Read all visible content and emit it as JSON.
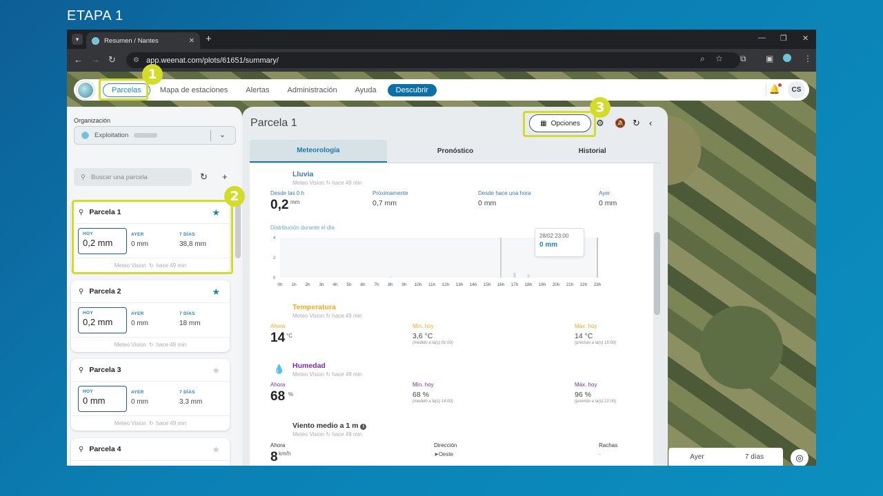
{
  "stage_title": "ETAPA 1",
  "browser": {
    "tab_title": "Resumen / Nantes",
    "url": "app.weenat.com/plots/61651/summary/"
  },
  "header": {
    "nav": [
      "Parcelas",
      "Mapa de estaciones",
      "Alertas",
      "Administración",
      "Ayuda"
    ],
    "discover_label": "Descubrir",
    "avatar_initials": "CS"
  },
  "sidebar": {
    "org_label": "Organización",
    "org_value": "Exploitation",
    "search_placeholder": "Buscar una parcela",
    "col_today": "HOY",
    "col_yesterday": "AYER",
    "col_week": "7 DÍAS",
    "footer_source": "Meteo Vision",
    "footer_time": "hace 49 min",
    "parcels": [
      {
        "name": "Parcela 1",
        "today": "0,2 mm",
        "yesterday": "0 mm",
        "week": "38,8 mm",
        "favorite": true
      },
      {
        "name": "Parcela 2",
        "today": "0,2 mm",
        "yesterday": "0 mm",
        "week": "18 mm",
        "favorite": true
      },
      {
        "name": "Parcela 3",
        "today": "0 mm",
        "yesterday": "0 mm",
        "week": "3,3 mm",
        "favorite": false
      },
      {
        "name": "Parcela 4",
        "today": "",
        "yesterday": "",
        "week": "",
        "favorite": false
      }
    ]
  },
  "main": {
    "title": "Parcela 1",
    "options_label": "Opciones",
    "tabs": [
      "Meteorología",
      "Pronóstico",
      "Historial"
    ],
    "source": "Meteo Vision",
    "time": "hace 49 min",
    "rain": {
      "title": "Lluvia",
      "lbl_since": "Desde las 0 h",
      "val_since": "0,2",
      "unit_since": "mm",
      "lbl_soon": "Próximamente",
      "val_soon": "0,7 mm",
      "lbl_hour": "Desde hace una hora",
      "val_hour": "0 mm",
      "lbl_yesterday": "Ayer",
      "val_yesterday": "0 mm",
      "chart_caption": "Distribución durante el día",
      "tooltip_date": "28/02 23:00",
      "tooltip_value": "0 mm"
    },
    "temperature": {
      "title": "Temperatura",
      "lbl_now": "Ahora",
      "val_now": "14",
      "unit": "°C",
      "lbl_min": "Mín. hoy",
      "val_min": "3,6 °C",
      "note_min": "(medido a la(s) 01:00)",
      "lbl_max": "Máx. hoy",
      "val_max": "14 °C",
      "note_max": "(previsto a la(s) 15:00)"
    },
    "humidity": {
      "title": "Humedad",
      "lbl_now": "Ahora",
      "val_now": "68",
      "unit": "%",
      "lbl_min": "Mín. hoy",
      "val_min": "68  %",
      "note_min": "(medido a la(s) 14:00)",
      "lbl_max": "Máx. hoy",
      "val_max": "96  %",
      "note_max": "(previsto a la(s) 21:00)"
    },
    "wind": {
      "title": "Viento medio a 1 m",
      "lbl_now": "Ahora",
      "val_now": "8",
      "unit": "km/h",
      "lbl_dir": "Dirección",
      "val_dir": "Oeste",
      "lbl_gusts": "Rachas",
      "val_gusts": "-"
    }
  },
  "map_tabs": [
    "Ayer",
    "7 días"
  ],
  "annotations": [
    "1",
    "2",
    "3"
  ],
  "chart_data": {
    "type": "bar",
    "categories": [
      "0h",
      "1h",
      "2h",
      "3h",
      "4h",
      "5h",
      "6h",
      "7h",
      "8h",
      "9h",
      "10h",
      "11h",
      "12h",
      "13h",
      "14h",
      "15h",
      "16h",
      "17h",
      "18h",
      "19h",
      "20h",
      "21h",
      "22h",
      "23h"
    ],
    "values": [
      0,
      0,
      0,
      0,
      0,
      0,
      0,
      0,
      0.1,
      0,
      0,
      0,
      0,
      0,
      0,
      0,
      0,
      0.5,
      0.3,
      0,
      0,
      0,
      0,
      0
    ],
    "yticks": [
      "0",
      "2",
      "4"
    ],
    "ylim": [
      0,
      4
    ],
    "grid": false
  },
  "colors": {
    "rain": "#3a78b8",
    "temperature": "#f2a81d",
    "humidity": "#7b2fa8",
    "wind": "#555555",
    "highlight": "#d4dc2a"
  }
}
